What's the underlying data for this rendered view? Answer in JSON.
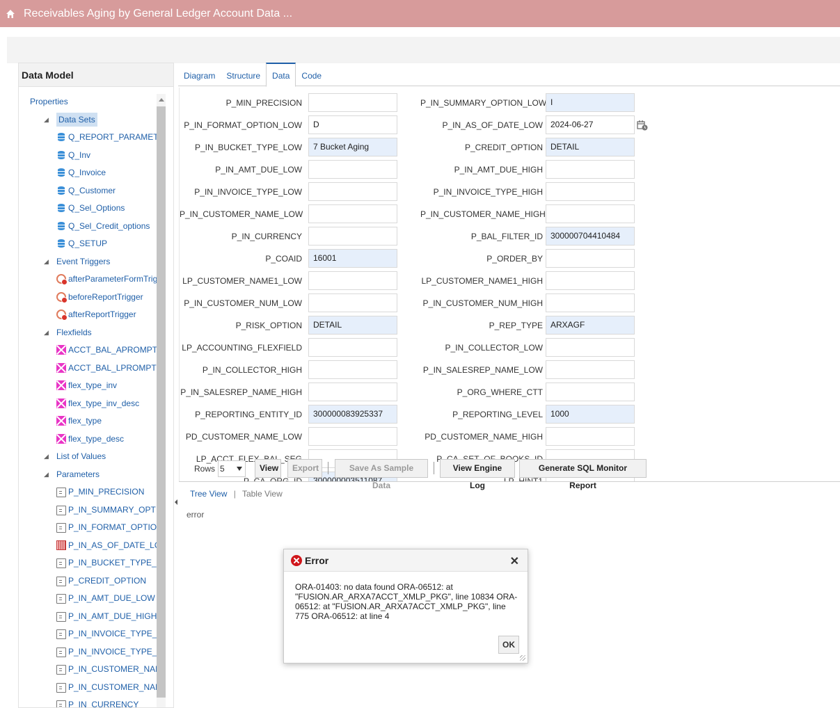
{
  "header": {
    "title": "Receivables Aging by General Ledger Account Data ..."
  },
  "sidebar": {
    "title": "Data Model",
    "tree": [
      {
        "label": "Properties",
        "level": 0,
        "icon": "none",
        "toggle": ""
      },
      {
        "label": "Data Sets",
        "level": 1,
        "icon": "none",
        "toggle": "◢",
        "selected": true
      },
      {
        "label": "Q_REPORT_PARAMETERS",
        "level": 2,
        "icon": "db"
      },
      {
        "label": "Q_Inv",
        "level": 2,
        "icon": "db"
      },
      {
        "label": "Q_Invoice",
        "level": 2,
        "icon": "db"
      },
      {
        "label": "Q_Customer",
        "level": 2,
        "icon": "db"
      },
      {
        "label": "Q_Sel_Options",
        "level": 2,
        "icon": "db"
      },
      {
        "label": "Q_Sel_Credit_options",
        "level": 2,
        "icon": "db"
      },
      {
        "label": "Q_SETUP",
        "level": 2,
        "icon": "db"
      },
      {
        "label": "Event Triggers",
        "level": 1,
        "icon": "none",
        "toggle": "◢"
      },
      {
        "label": "afterParameterFormTrigger",
        "level": 2,
        "icon": "trig"
      },
      {
        "label": "beforeReportTrigger",
        "level": 2,
        "icon": "trig"
      },
      {
        "label": "afterReportTrigger",
        "level": 2,
        "icon": "trig"
      },
      {
        "label": "Flexfields",
        "level": 1,
        "icon": "none",
        "toggle": "◢"
      },
      {
        "label": "ACCT_BAL_APROMPT",
        "level": 2,
        "icon": "flex"
      },
      {
        "label": "ACCT_BAL_LPROMPT",
        "level": 2,
        "icon": "flex"
      },
      {
        "label": "flex_type_inv",
        "level": 2,
        "icon": "flex"
      },
      {
        "label": "flex_type_inv_desc",
        "level": 2,
        "icon": "flex"
      },
      {
        "label": "flex_type",
        "level": 2,
        "icon": "flex"
      },
      {
        "label": "flex_type_desc",
        "level": 2,
        "icon": "flex"
      },
      {
        "label": "List of Values",
        "level": 1,
        "icon": "none",
        "toggle": "◢"
      },
      {
        "label": "Parameters",
        "level": 1,
        "icon": "none",
        "toggle": "◢"
      },
      {
        "label": "P_MIN_PRECISION",
        "level": 2,
        "icon": "param"
      },
      {
        "label": "P_IN_SUMMARY_OPTION_LOW",
        "level": 2,
        "icon": "param"
      },
      {
        "label": "P_IN_FORMAT_OPTION_LOW",
        "level": 2,
        "icon": "param"
      },
      {
        "label": "P_IN_AS_OF_DATE_LOW",
        "level": 2,
        "icon": "cal"
      },
      {
        "label": "P_IN_BUCKET_TYPE_LOW",
        "level": 2,
        "icon": "param"
      },
      {
        "label": "P_CREDIT_OPTION",
        "level": 2,
        "icon": "param"
      },
      {
        "label": "P_IN_AMT_DUE_LOW",
        "level": 2,
        "icon": "param"
      },
      {
        "label": "P_IN_AMT_DUE_HIGH",
        "level": 2,
        "icon": "param"
      },
      {
        "label": "P_IN_INVOICE_TYPE_LOW",
        "level": 2,
        "icon": "param"
      },
      {
        "label": "P_IN_INVOICE_TYPE_HIGH",
        "level": 2,
        "icon": "param"
      },
      {
        "label": "P_IN_CUSTOMER_NAME_LOW",
        "level": 2,
        "icon": "param"
      },
      {
        "label": "P_IN_CUSTOMER_NAME_HIGH",
        "level": 2,
        "icon": "param"
      },
      {
        "label": "P_IN_CURRENCY",
        "level": 2,
        "icon": "param"
      }
    ]
  },
  "tabs": [
    {
      "label": "Diagram",
      "active": false
    },
    {
      "label": "Structure",
      "active": false
    },
    {
      "label": "Data",
      "active": true
    },
    {
      "label": "Code",
      "active": false
    }
  ],
  "params": {
    "left": [
      {
        "label": "P_MIN_PRECISION",
        "value": "",
        "filled": false
      },
      {
        "label": "P_IN_FORMAT_OPTION_LOW",
        "value": "D",
        "filled": false
      },
      {
        "label": "P_IN_BUCKET_TYPE_LOW",
        "value": "7 Bucket Aging",
        "filled": true
      },
      {
        "label": "P_IN_AMT_DUE_LOW",
        "value": "",
        "filled": false
      },
      {
        "label": "P_IN_INVOICE_TYPE_LOW",
        "value": "",
        "filled": false
      },
      {
        "label": "P_IN_CUSTOMER_NAME_LOW",
        "value": "",
        "filled": false
      },
      {
        "label": "P_IN_CURRENCY",
        "value": "",
        "filled": false
      },
      {
        "label": "P_COAID",
        "value": "16001",
        "filled": true
      },
      {
        "label": "LP_CUSTOMER_NAME1_LOW",
        "value": "",
        "filled": false
      },
      {
        "label": "P_IN_CUSTOMER_NUM_LOW",
        "value": "",
        "filled": false
      },
      {
        "label": "P_RISK_OPTION",
        "value": "DETAIL",
        "filled": true
      },
      {
        "label": "LP_ACCOUNTING_FLEXFIELD",
        "value": "",
        "filled": false
      },
      {
        "label": "P_IN_COLLECTOR_HIGH",
        "value": "",
        "filled": false
      },
      {
        "label": "P_IN_SALESREP_NAME_HIGH",
        "value": "",
        "filled": false
      },
      {
        "label": "P_REPORTING_ENTITY_ID",
        "value": "300000083925337",
        "filled": true
      },
      {
        "label": "PD_CUSTOMER_NAME_LOW",
        "value": "",
        "filled": false
      },
      {
        "label": "LP_ACCT_FLEX_BAL_SEG",
        "value": "",
        "filled": false
      },
      {
        "label": "P_CA_ORG_ID",
        "value": "300000003511087",
        "filled": true
      }
    ],
    "right": [
      {
        "label": "P_IN_SUMMARY_OPTION_LOW",
        "value": "I",
        "filled": true
      },
      {
        "label": "P_IN_AS_OF_DATE_LOW",
        "value": "2024-06-27",
        "filled": false
      },
      {
        "label": "P_CREDIT_OPTION",
        "value": "DETAIL",
        "filled": true
      },
      {
        "label": "P_IN_AMT_DUE_HIGH",
        "value": "",
        "filled": false
      },
      {
        "label": "P_IN_INVOICE_TYPE_HIGH",
        "value": "",
        "filled": false
      },
      {
        "label": "P_IN_CUSTOMER_NAME_HIGH",
        "value": "",
        "filled": false
      },
      {
        "label": "P_BAL_FILTER_ID",
        "value": "300000704410484",
        "filled": true
      },
      {
        "label": "P_ORDER_BY",
        "value": "",
        "filled": false
      },
      {
        "label": "LP_CUSTOMER_NAME1_HIGH",
        "value": "",
        "filled": false
      },
      {
        "label": "P_IN_CUSTOMER_NUM_HIGH",
        "value": "",
        "filled": false
      },
      {
        "label": "P_REP_TYPE",
        "value": "ARXAGF",
        "filled": true
      },
      {
        "label": "P_IN_COLLECTOR_LOW",
        "value": "",
        "filled": false
      },
      {
        "label": "P_IN_SALESREP_NAME_LOW",
        "value": "",
        "filled": false
      },
      {
        "label": "P_ORG_WHERE_CTT",
        "value": "",
        "filled": false
      },
      {
        "label": "P_REPORTING_LEVEL",
        "value": "1000",
        "filled": true
      },
      {
        "label": "PD_CUSTOMER_NAME_HIGH",
        "value": "",
        "filled": false
      },
      {
        "label": "P_CA_SET_OF_BOOKS_ID",
        "value": "",
        "filled": false
      },
      {
        "label": "LP_HINT1",
        "value": "",
        "filled": false
      }
    ]
  },
  "toolbar": {
    "rows_label": "Rows",
    "rows_value": "5",
    "view": "View",
    "export": "Export",
    "save_sample": "Save As Sample Data",
    "engine_log": "View Engine Log",
    "sql_monitor": "Generate SQL Monitor Report"
  },
  "view_tabs": {
    "tree": "Tree View",
    "sep": "|",
    "table": "Table View"
  },
  "result": {
    "text": "error"
  },
  "dialog": {
    "title": "Error",
    "close": "✕",
    "message": "ORA-01403: no data found ORA-06512: at \"FUSION.AR_ARXA7ACCT_XMLP_PKG\", line 10834 ORA-06512: at \"FUSION.AR_ARXA7ACCT_XMLP_PKG\", line 775 ORA-06512: at line 4",
    "ok": "OK"
  },
  "colors": {
    "header": "#d79b9b",
    "link": "#1f5fa8",
    "filled_input": "#e6effb",
    "error": "#d0161b"
  }
}
